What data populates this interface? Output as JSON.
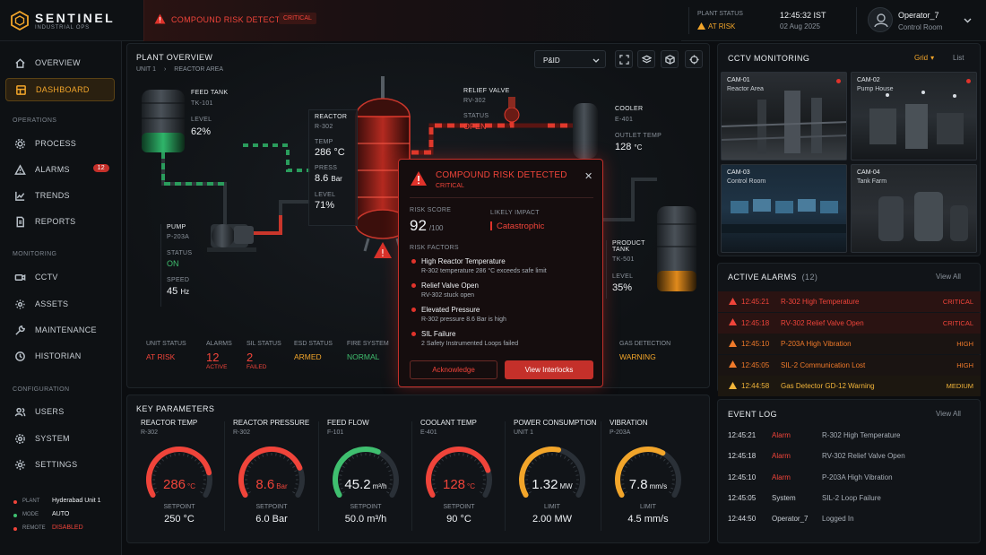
{
  "brand": {
    "name": "SENTINEL",
    "sub": "INDUSTRIAL OPS"
  },
  "topbar": {
    "alert": "COMPOUND RISK DETECTED",
    "alert_badge": "CRITICAL",
    "plant_status_label": "PLANT STATUS",
    "plant_status_value": "AT RISK",
    "time": "12:45:32 IST",
    "date": "02 Aug 2025",
    "user_name": "Operator_7",
    "user_role": "Control Room"
  },
  "sidebar": {
    "overview": "OVERVIEW",
    "dashboard": "DASHBOARD",
    "sec_operations": "OPERATIONS",
    "process": "PROCESS",
    "alarms": "ALARMS",
    "alarms_count": "12",
    "trends": "TRENDS",
    "reports": "REPORTS",
    "sec_monitoring": "MONITORING",
    "cctv": "CCTV",
    "assets": "ASSETS",
    "maintenance": "MAINTENANCE",
    "historian": "HISTORIAN",
    "sec_configuration": "CONFIGURATION",
    "users": "USERS",
    "system": "SYSTEM",
    "settings": "SETTINGS",
    "footer": [
      {
        "label": "PLANT",
        "value": "Hyderabad Unit 1",
        "color": "#f0443a"
      },
      {
        "label": "MODE",
        "value": "AUTO",
        "color": "#3fbf6f"
      },
      {
        "label": "REMOTE",
        "value": "DISABLED",
        "color": "#f0443a"
      }
    ]
  },
  "plant": {
    "title": "PLANT OVERVIEW",
    "crumb1": "UNIT 1",
    "crumb2": "REACTOR AREA",
    "view_select": "P&ID",
    "feed_tank": {
      "title": "FEED TANK",
      "id": "TK-101",
      "level_label": "LEVEL",
      "level": "62%"
    },
    "reactor": {
      "title": "REACTOR",
      "id": "R-302",
      "temp_label": "TEMP",
      "temp": "286 °C",
      "press_label": "PRESS",
      "press": "8.6",
      "press_unit": "Bar",
      "level_label": "LEVEL",
      "level": "71%"
    },
    "relief": {
      "title": "RELIEF VALVE",
      "id": "RV-302",
      "status_label": "STATUS",
      "status": "OPEN"
    },
    "cooler": {
      "title": "COOLER",
      "id": "E-401",
      "outlet_label": "OUTLET TEMP",
      "outlet": "128",
      "outlet_unit": "°C"
    },
    "pump": {
      "title": "PUMP",
      "id": "P-203A",
      "status_label": "STATUS",
      "status": "ON",
      "speed_label": "SPEED",
      "speed": "45",
      "speed_unit": "Hz"
    },
    "product": {
      "title": "PRODUCT TANK",
      "id": "TK-501",
      "level_label": "LEVEL",
      "level": "35%"
    },
    "status_strip": {
      "unit_label": "UNIT STATUS",
      "unit": "AT RISK",
      "alarms_label": "ALARMS",
      "alarms": "12",
      "alarms_sub": "ACTIVE",
      "sil_label": "SIL STATUS",
      "sil": "2",
      "sil_sub": "FAILED",
      "esd_label": "ESD STATUS",
      "esd": "ARMED",
      "fire_label": "FIRE SYSTEM",
      "fire": "NORMAL",
      "gas_label": "GAS DETECTION",
      "gas": "WARNING"
    }
  },
  "modal": {
    "title": "COMPOUND RISK DETECTED",
    "subtitle": "CRITICAL",
    "score_label": "RISK SCORE",
    "score": "92",
    "score_max": "/100",
    "impact_label": "LIKELY IMPACT",
    "impact": "Catastrophic",
    "factors_label": "RISK FACTORS",
    "factors": [
      {
        "title": "High Reactor Temperature",
        "desc": "R-302 temperature 286 °C exceeds safe limit"
      },
      {
        "title": "Relief Valve Open",
        "desc": "RV-302 stuck open"
      },
      {
        "title": "Elevated Pressure",
        "desc": "R-302 pressure 8.6 Bar is high"
      },
      {
        "title": "SIL Failure",
        "desc": "2 Safety Instrumented Loops failed"
      }
    ],
    "ack": "Acknowledge",
    "interlocks": "View Interlocks"
  },
  "cctv": {
    "title": "CCTV MONITORING",
    "grid": "Grid",
    "list": "List",
    "cams": [
      {
        "id": "CAM-01",
        "name": "Reactor Area"
      },
      {
        "id": "CAM-02",
        "name": "Pump House"
      },
      {
        "id": "CAM-03",
        "name": "Control Room"
      },
      {
        "id": "CAM-04",
        "name": "Tank Farm"
      }
    ]
  },
  "alarms": {
    "title": "ACTIVE ALARMS",
    "count": "(12)",
    "view_all": "View All",
    "rows": [
      {
        "time": "12:45:21",
        "msg": "R-302 High Temperature",
        "sev": "CRITICAL",
        "color": "#f0443a"
      },
      {
        "time": "12:45:18",
        "msg": "RV-302 Relief Valve Open",
        "sev": "CRITICAL",
        "color": "#f0443a"
      },
      {
        "time": "12:45:10",
        "msg": "P-203A High Vibration",
        "sev": "HIGH",
        "color": "#f07a2a"
      },
      {
        "time": "12:45:05",
        "msg": "SIL-2 Communication Lost",
        "sev": "HIGH",
        "color": "#f07a2a"
      },
      {
        "time": "12:44:58",
        "msg": "Gas Detector GD-12 Warning",
        "sev": "MEDIUM",
        "color": "#f2b53a"
      }
    ]
  },
  "events": {
    "title": "EVENT LOG",
    "view_all": "View All",
    "rows": [
      {
        "time": "12:45:21",
        "who": "Alarm",
        "msg": "R-302 High Temperature"
      },
      {
        "time": "12:45:18",
        "who": "Alarm",
        "msg": "RV-302 Relief Valve Open"
      },
      {
        "time": "12:45:10",
        "who": "Alarm",
        "msg": "P-203A High Vibration"
      },
      {
        "time": "12:45:05",
        "who": "System",
        "msg": "SIL-2 Loop Failure"
      },
      {
        "time": "12:44:50",
        "who": "Operator_7",
        "msg": "Logged In"
      }
    ]
  },
  "params": {
    "title": "KEY PARAMETERS",
    "gauges": [
      {
        "title": "REACTOR TEMP",
        "sub": "R-302",
        "value": "286",
        "unit": "°C",
        "fraction": 0.82,
        "color": "#f0443a",
        "set_label": "SETPOINT",
        "set": "250 °C"
      },
      {
        "title": "REACTOR PRESSURE",
        "sub": "R-302",
        "value": "8.6",
        "unit": "Bar",
        "fraction": 0.78,
        "color": "#f0443a",
        "set_label": "SETPOINT",
        "set": "6.0 Bar"
      },
      {
        "title": "FEED FLOW",
        "sub": "F-101",
        "value": "45.2",
        "unit": "m³/h",
        "fraction": 0.6,
        "color": "#3fbf6f",
        "set_label": "SETPOINT",
        "set": "50.0 m³/h"
      },
      {
        "title": "COOLANT TEMP",
        "sub": "E-401",
        "value": "128",
        "unit": "°C",
        "fraction": 0.8,
        "color": "#f0443a",
        "set_label": "SETPOINT",
        "set": "90 °C"
      },
      {
        "title": "POWER CONSUMPTION",
        "sub": "UNIT 1",
        "value": "1.32",
        "unit": "MW",
        "fraction": 0.55,
        "color": "#f2a52a",
        "set_label": "LIMIT",
        "set": "2.00 MW"
      },
      {
        "title": "VIBRATION",
        "sub": "P-203A",
        "value": "7.8",
        "unit": "mm/s",
        "fraction": 0.62,
        "color": "#f2a52a",
        "set_label": "LIMIT",
        "set": "4.5 mm/s"
      }
    ]
  }
}
